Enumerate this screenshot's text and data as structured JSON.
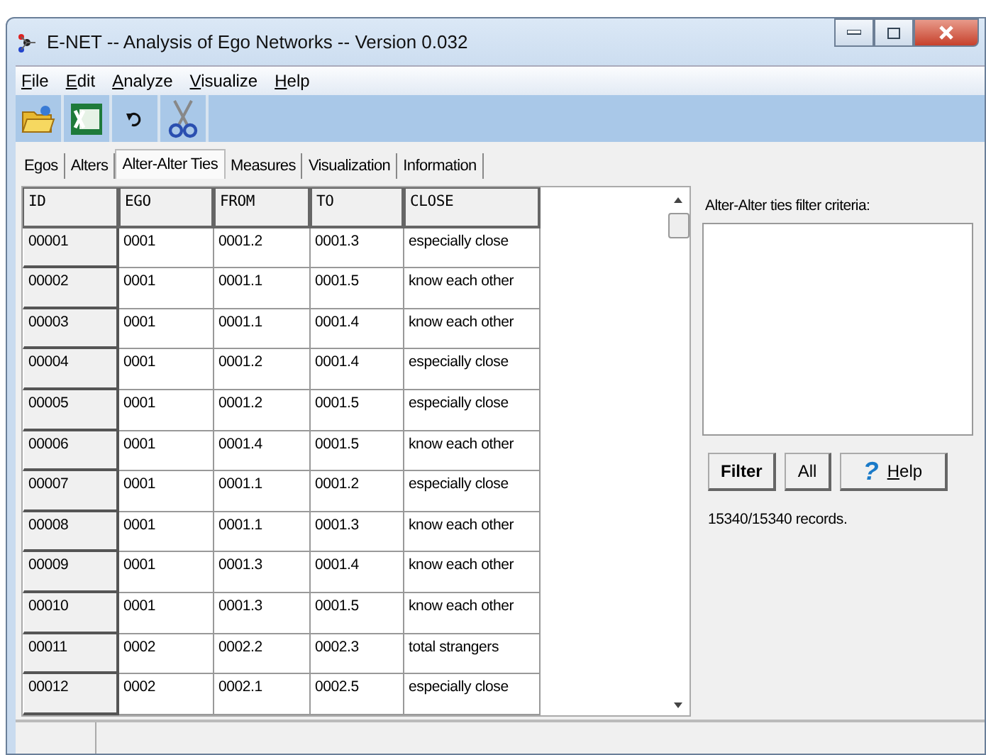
{
  "window": {
    "title": "E-NET -- Analysis of Ego Networks -- Version 0.032"
  },
  "menu": [
    "File",
    "Edit",
    "Analyze",
    "Visualize",
    "Help"
  ],
  "tabs": [
    {
      "label": "Egos",
      "selected": false
    },
    {
      "label": "Alters",
      "selected": false
    },
    {
      "label": "Alter-Alter Ties",
      "selected": true
    },
    {
      "label": "Measures",
      "selected": false
    },
    {
      "label": "Visualization",
      "selected": false
    },
    {
      "label": "Information",
      "selected": false
    }
  ],
  "table": {
    "columns": [
      "ID",
      "EGO",
      "FROM",
      "TO",
      "CLOSE"
    ],
    "rows": [
      [
        "00001",
        "0001",
        "0001.2",
        "0001.3",
        "especially close"
      ],
      [
        "00002",
        "0001",
        "0001.1",
        "0001.5",
        "know each other"
      ],
      [
        "00003",
        "0001",
        "0001.1",
        "0001.4",
        "know each other"
      ],
      [
        "00004",
        "0001",
        "0001.2",
        "0001.4",
        "especially close"
      ],
      [
        "00005",
        "0001",
        "0001.2",
        "0001.5",
        "especially close"
      ],
      [
        "00006",
        "0001",
        "0001.4",
        "0001.5",
        "know each other"
      ],
      [
        "00007",
        "0001",
        "0001.1",
        "0001.2",
        "especially close"
      ],
      [
        "00008",
        "0001",
        "0001.1",
        "0001.3",
        "know each other"
      ],
      [
        "00009",
        "0001",
        "0001.3",
        "0001.4",
        "know each other"
      ],
      [
        "00010",
        "0001",
        "0001.3",
        "0001.5",
        "know each other"
      ],
      [
        "00011",
        "0002",
        "0002.2",
        "0002.3",
        "total strangers"
      ],
      [
        "00012",
        "0002",
        "0002.1",
        "0002.5",
        "especially close"
      ]
    ]
  },
  "filter_panel": {
    "label": "Alter-Alter ties filter criteria:",
    "buttons": [
      "Filter",
      "All",
      "Help"
    ],
    "help_glyph": "?",
    "records": "15340/15340 records."
  }
}
